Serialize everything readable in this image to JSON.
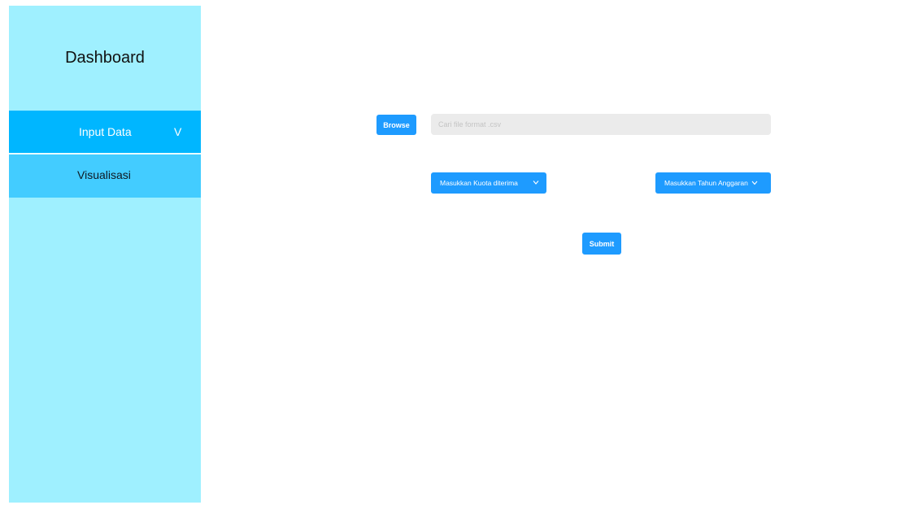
{
  "sidebar": {
    "title": "Dashboard",
    "items": [
      {
        "label": "Input Data",
        "chevron": "V",
        "active": true,
        "color": "#00b6ff"
      },
      {
        "label": "Visualisasi",
        "active": false,
        "color": "#43ccff"
      }
    ],
    "background": "#9ff0ff"
  },
  "main": {
    "browse_label": "Browse",
    "file_placeholder": "Cari file format .csv",
    "kuota_label": "Masukkan Kuota diterima",
    "tahun_label": "Masukkan Tahun Anggaran",
    "dropdown_icon": "chevron-down-icon",
    "submit_label": "Submit",
    "accent": "#1e9bff"
  }
}
